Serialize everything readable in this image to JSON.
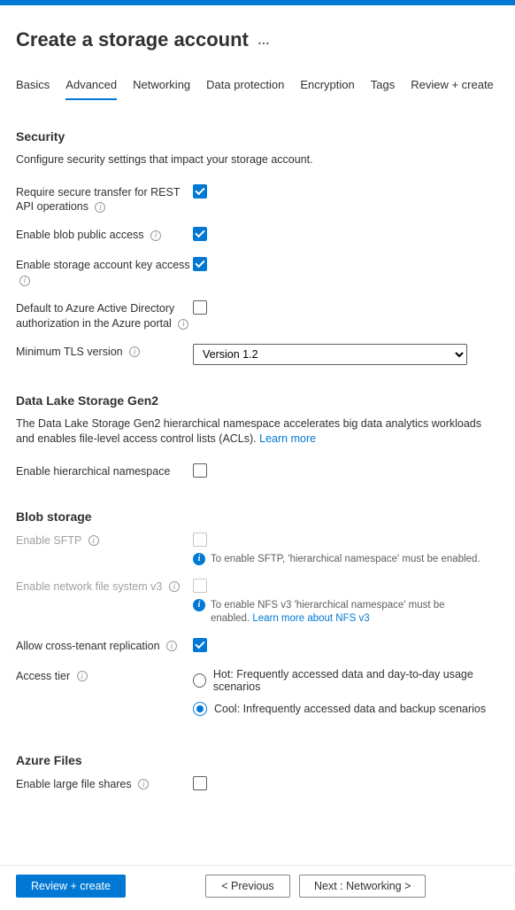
{
  "header": {
    "title": "Create a storage account"
  },
  "tabs": [
    {
      "label": "Basics",
      "active": false
    },
    {
      "label": "Advanced",
      "active": true
    },
    {
      "label": "Networking",
      "active": false
    },
    {
      "label": "Data protection",
      "active": false
    },
    {
      "label": "Encryption",
      "active": false
    },
    {
      "label": "Tags",
      "active": false
    },
    {
      "label": "Review + create",
      "active": false
    }
  ],
  "security": {
    "title": "Security",
    "desc": "Configure security settings that impact your storage account.",
    "require_secure_transfer": {
      "label": "Require secure transfer for REST API operations",
      "checked": true
    },
    "enable_blob_public": {
      "label": "Enable blob public access",
      "checked": true
    },
    "enable_key_access": {
      "label": "Enable storage account key access",
      "checked": true
    },
    "default_aad": {
      "label": "Default to Azure Active Directory authorization in the Azure portal",
      "checked": false
    },
    "min_tls": {
      "label": "Minimum TLS version",
      "value": "Version 1.2"
    }
  },
  "datalake": {
    "title": "Data Lake Storage Gen2",
    "desc": "The Data Lake Storage Gen2 hierarchical namespace accelerates big data analytics workloads and enables file-level access control lists (ACLs).",
    "learn_more": "Learn more",
    "enable_hns": {
      "label": "Enable hierarchical namespace",
      "checked": false
    }
  },
  "blob": {
    "title": "Blob storage",
    "enable_sftp": {
      "label": "Enable SFTP",
      "checked": false,
      "disabled": true,
      "hint": "To enable SFTP, 'hierarchical namespace' must be enabled."
    },
    "enable_nfs": {
      "label": "Enable network file system v3",
      "checked": false,
      "disabled": true,
      "hint": "To enable NFS v3 'hierarchical namespace' must be enabled.",
      "hint_link": "Learn more about NFS v3"
    },
    "cross_tenant": {
      "label": "Allow cross-tenant replication",
      "checked": true
    },
    "access_tier": {
      "label": "Access tier",
      "selected": "cool",
      "hot": "Hot: Frequently accessed data and day-to-day usage scenarios",
      "cool": "Cool: Infrequently accessed data and backup scenarios"
    }
  },
  "azure_files": {
    "title": "Azure Files",
    "large_file_shares": {
      "label": "Enable large file shares",
      "checked": false
    }
  },
  "footer": {
    "review": "Review + create",
    "previous": "< Previous",
    "next": "Next : Networking >"
  }
}
